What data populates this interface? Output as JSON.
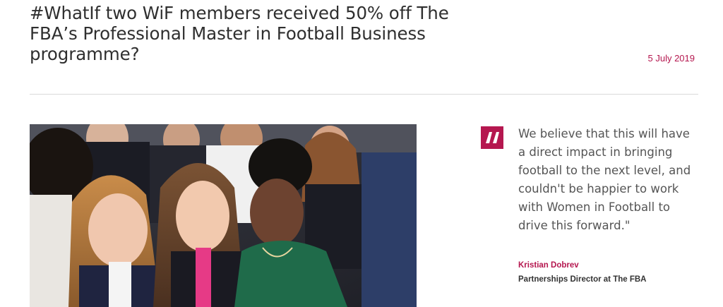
{
  "article": {
    "headline": "#WhatIf two WiF members received 50% off The FBA’s Professional Master in Football Business programme?",
    "date": "5 July 2019"
  },
  "quote": {
    "text": "We believe that this will have a direct impact in bringing football to the next level, and couldn't be happier to work with Women in Football to drive this forward.\"",
    "author": "Kristian Dobrev",
    "role": "Partnerships Director at The FBA",
    "icon": "quote-mark-icon"
  },
  "colors": {
    "accent": "#b5174f",
    "text": "#2f2f2f",
    "divider": "#d9d9d9"
  }
}
